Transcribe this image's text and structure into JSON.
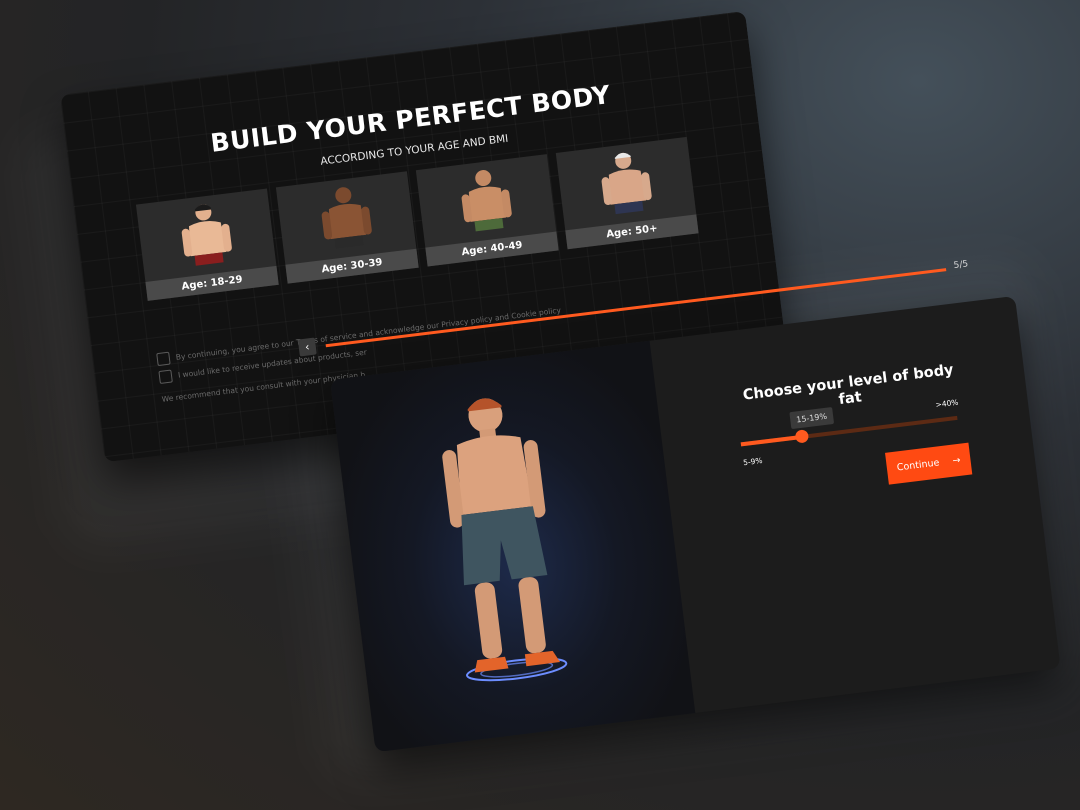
{
  "back": {
    "title": "BUILD YOUR PERFECT BODY",
    "subtitle": "ACCORDING TO YOUR AGE AND BMI",
    "ages": [
      "Age: 18-29",
      "Age: 30-39",
      "Age: 40-49",
      "Age: 50+"
    ],
    "consent_1": "By continuing, you agree to our Terms of service and acknowledge our Privacy policy and Cookie policy",
    "consent_2": "I would like to receive updates about products, ser",
    "disclaimer": "We recommend that you consult with your physician b"
  },
  "front": {
    "step": "5/5",
    "progress": 1.0,
    "question": "Choose your level of body fat",
    "slider": {
      "value_label": "15-19%",
      "min_label": "5-9%",
      "max_label": ">40%",
      "position": 0.28
    },
    "continue_label": "Continue",
    "continue_icon": "arrow-right-icon",
    "back_icon": "chevron-left-icon"
  },
  "colors": {
    "accent": "#ff5a1f",
    "card": "#1c1c1c",
    "background": "#232426"
  }
}
